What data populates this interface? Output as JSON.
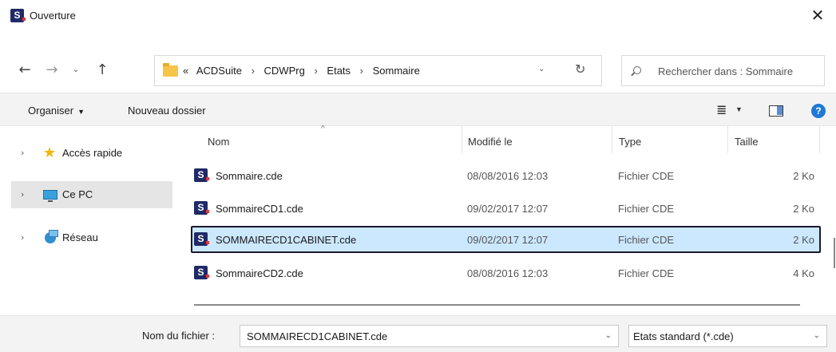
{
  "window": {
    "title": "Ouverture",
    "close_glyph": "✕",
    "app_icon_letter": "S"
  },
  "nav": {
    "back": "←",
    "forward": "→",
    "recent": "⌄",
    "up": "↑"
  },
  "address": {
    "prefix": "«",
    "crumbs": [
      "ACDSuite",
      "CDWPrg",
      "Etats",
      "Sommaire"
    ],
    "separator": "›",
    "dropdown": "⌄",
    "refresh": "↻"
  },
  "search": {
    "placeholder": "Rechercher dans : Sommaire"
  },
  "toolbar": {
    "organize": "Organiser",
    "organize_caret": "▼",
    "new_folder": "Nouveau dossier",
    "view_glyph": "≣",
    "view_caret": "▼",
    "help": "?"
  },
  "sidebar": {
    "chevron": "›",
    "items": [
      {
        "label": "Accès rapide",
        "icon": "star-icon"
      },
      {
        "label": "Ce PC",
        "icon": "pc-icon"
      },
      {
        "label": "Réseau",
        "icon": "network-icon"
      }
    ]
  },
  "columns": {
    "sort_glyph": "^",
    "name": "Nom",
    "modified": "Modifié le",
    "type": "Type",
    "size": "Taille"
  },
  "files": [
    {
      "name": "Sommaire.cde",
      "modified": "08/08/2016 12:03",
      "type": "Fichier CDE",
      "size": "2 Ko"
    },
    {
      "name": "SommaireCD1.cde",
      "modified": "09/02/2017 12:07",
      "type": "Fichier CDE",
      "size": "2 Ko"
    },
    {
      "name": "SOMMAIRECD1CABINET.cde",
      "modified": "09/02/2017 12:07",
      "type": "Fichier CDE",
      "size": "2 Ko"
    },
    {
      "name": "SommaireCD2.cde",
      "modified": "08/08/2016 12:03",
      "type": "Fichier CDE",
      "size": "4 Ko"
    }
  ],
  "footer": {
    "filename_label": "Nom du fichier :",
    "filename_value": "SOMMAIRECD1CABINET.cde",
    "filetype_value": "Etats standard (*.cde)",
    "caret": "⌄"
  },
  "colors": {
    "selection_bg": "#cce8ff",
    "accent": "#1f79d6",
    "app_icon": "#1f2a66"
  }
}
